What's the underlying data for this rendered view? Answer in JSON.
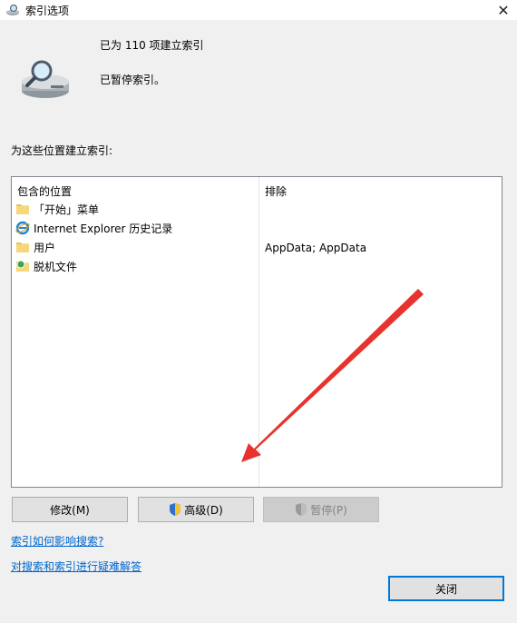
{
  "window": {
    "title": "索引选项",
    "close_glyph": "✕"
  },
  "status": {
    "indexed": "已为 110 项建立索引",
    "paused": "已暂停索引。"
  },
  "locations": {
    "label": "为这些位置建立索引:",
    "col_included": "包含的位置",
    "col_exclude": "排除",
    "rows": [
      {
        "name": "「开始」菜单",
        "exclude": "",
        "icon": "folder-icon"
      },
      {
        "name": "Internet Explorer 历史记录",
        "exclude": "",
        "icon": "internet-explorer-icon"
      },
      {
        "name": "用户",
        "exclude": "AppData; AppData",
        "icon": "folder-icon"
      },
      {
        "name": "脱机文件",
        "exclude": "",
        "icon": "offline-files-icon"
      }
    ]
  },
  "buttons": {
    "modify": "修改(M)",
    "advanced": "高级(D)",
    "pause": "暂停(P)",
    "close": "关闭"
  },
  "links": {
    "how_affects": "索引如何影响搜索?",
    "troubleshoot": "对搜索和索引进行疑难解答"
  },
  "colors": {
    "arrow": "#e8322d",
    "link": "#0066cc",
    "focus_border": "#0078d7"
  }
}
